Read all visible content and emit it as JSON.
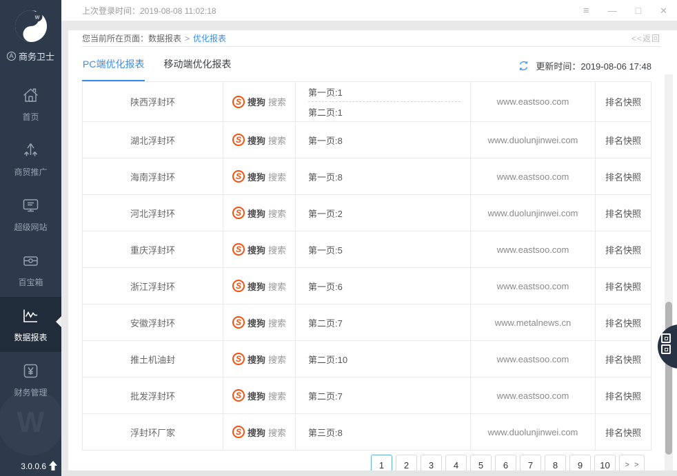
{
  "window": {
    "last_login": "上次登录时间：2019-08-08 11:02:18",
    "controls": {
      "menu": "≡",
      "minimize": "—",
      "maximize": "□",
      "close": "✕"
    }
  },
  "sidebar": {
    "brand": "商务卫士",
    "brand_badge": "A",
    "version": "3.0.0.6",
    "watermark_letter": "W",
    "items": [
      {
        "id": "home",
        "label": "首页",
        "icon": "home-icon",
        "active": false
      },
      {
        "id": "promote",
        "label": "商贸推广",
        "icon": "promote-icon",
        "active": false
      },
      {
        "id": "website",
        "label": "超级网站",
        "icon": "monitor-icon",
        "active": false
      },
      {
        "id": "toolbox",
        "label": "百宝箱",
        "icon": "toolbox-icon",
        "active": false
      },
      {
        "id": "reports",
        "label": "数据报表",
        "icon": "chart-icon",
        "active": true
      },
      {
        "id": "finance",
        "label": "财务管理",
        "icon": "finance-icon",
        "active": false
      }
    ]
  },
  "breadcrumb": {
    "prefix": "您当前所在页面：",
    "parent": "数据报表",
    "separator": ">",
    "current": "优化报表",
    "back": "<<返回"
  },
  "toolbar": {
    "tabs": [
      {
        "label": "PC端优化报表",
        "active": true
      },
      {
        "label": "移动端优化报表",
        "active": false
      }
    ],
    "update_time": "更新时间：2019-08-06 17:48"
  },
  "table": {
    "engine": "搜狗搜索",
    "snapshot_label": "排名快照",
    "rows": [
      {
        "keyword": "陕西浮封环",
        "pages": [
          "第一页:1",
          "第二页:1"
        ],
        "site": "www.eastsoo.com"
      },
      {
        "keyword": "湖北浮封环",
        "pages": [
          "第一页:8"
        ],
        "site": "www.duolunjinwei.com"
      },
      {
        "keyword": "海南浮封环",
        "pages": [
          "第一页:8"
        ],
        "site": "www.eastsoo.com"
      },
      {
        "keyword": "河北浮封环",
        "pages": [
          "第一页:2"
        ],
        "site": "www.duolunjinwei.com"
      },
      {
        "keyword": "重庆浮封环",
        "pages": [
          "第一页:5"
        ],
        "site": "www.eastsoo.com"
      },
      {
        "keyword": "浙江浮封环",
        "pages": [
          "第一页:6"
        ],
        "site": "www.eastsoo.com"
      },
      {
        "keyword": "安徽浮封环",
        "pages": [
          "第二页:7"
        ],
        "site": "www.metalnews.cn"
      },
      {
        "keyword": "推土机油封",
        "pages": [
          "第二页:10"
        ],
        "site": "www.eastsoo.com"
      },
      {
        "keyword": "批发浮封环",
        "pages": [
          "第二页:7"
        ],
        "site": "www.eastsoo.com"
      },
      {
        "keyword": "浮封环厂家",
        "pages": [
          "第三页:8"
        ],
        "site": "www.duolunjinwei.com"
      }
    ]
  },
  "pagination": {
    "pages": [
      "1",
      "2",
      "3",
      "4",
      "5",
      "6",
      "7",
      "8",
      "9",
      "10"
    ],
    "active_page": "1",
    "next_label": "> >"
  },
  "colors": {
    "accent_blue": "#3a8ce8",
    "sogou_red": "#f4510f",
    "sidebar_bg": "#2d3a4b",
    "sidebar_active_bg": "#212c3b",
    "table_border": "#e9e9e9"
  }
}
